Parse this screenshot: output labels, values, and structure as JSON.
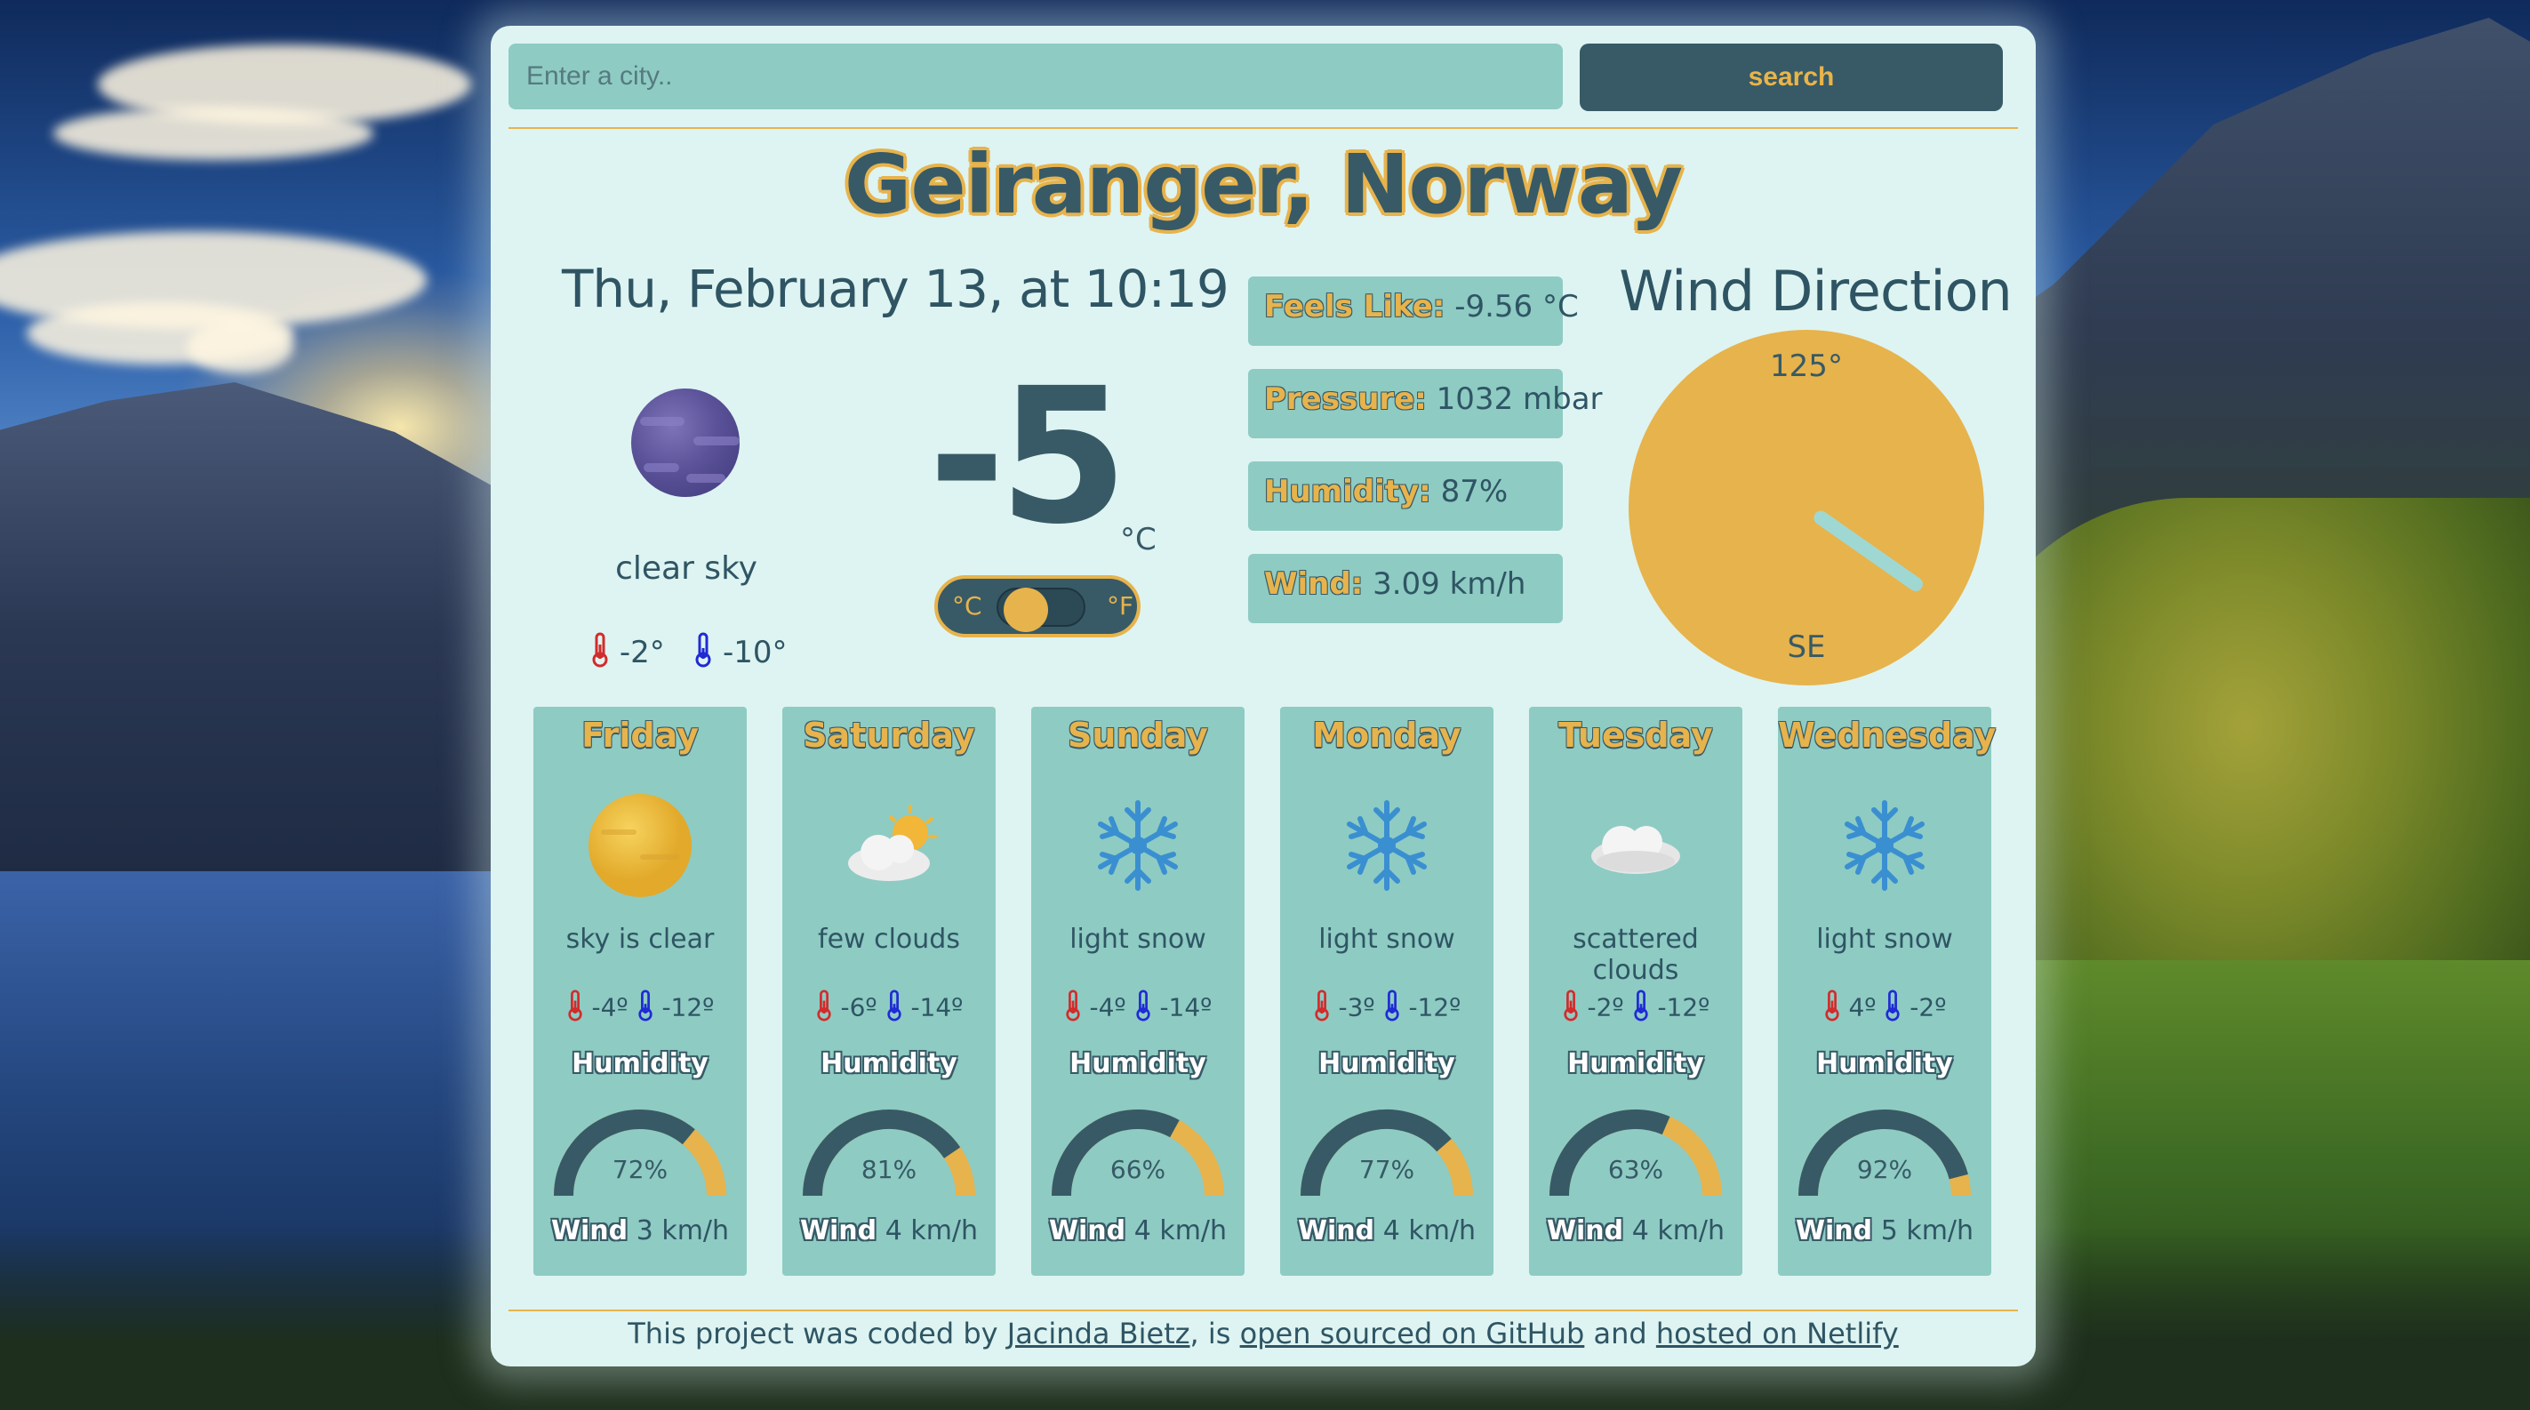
{
  "search": {
    "placeholder": "Enter a city..",
    "button_label": "search"
  },
  "current": {
    "city": "Geiranger, Norway",
    "datetime": "Thu, February 13, at 10:19",
    "icon": "moon-icon",
    "description": "clear sky",
    "high": "-2°",
    "low": "-10°",
    "temperature": "-5",
    "unit": "°C",
    "toggle": {
      "celsius_label": "°C",
      "fahrenheit_label": "°F",
      "selected": "celsius"
    },
    "stats": [
      {
        "label": "Feels Like:",
        "value": "-9.56 °C"
      },
      {
        "label": "Pressure:",
        "value": "1032 mbar"
      },
      {
        "label": "Humidity:",
        "value": "87%"
      },
      {
        "label": "Wind:",
        "value": "3.09 km/h"
      }
    ]
  },
  "wind_direction": {
    "title": "Wind Direction",
    "degrees_label": "125°",
    "degrees": 125,
    "cardinal": "SE"
  },
  "forecast": [
    {
      "day": "Friday",
      "icon": "sun-icon",
      "description": "sky is clear",
      "high": "-4º",
      "low": "-12º",
      "humidity_label": "Humidity",
      "humidity": 72,
      "humidity_text": "72%",
      "wind_label": "Wind",
      "wind": "3 km/h"
    },
    {
      "day": "Saturday",
      "icon": "few-clouds-icon",
      "description": "few clouds",
      "high": "-6º",
      "low": "-14º",
      "humidity_label": "Humidity",
      "humidity": 81,
      "humidity_text": "81%",
      "wind_label": "Wind",
      "wind": "4 km/h"
    },
    {
      "day": "Sunday",
      "icon": "snowflake-icon",
      "description": "light snow",
      "high": "-4º",
      "low": "-14º",
      "humidity_label": "Humidity",
      "humidity": 66,
      "humidity_text": "66%",
      "wind_label": "Wind",
      "wind": "4 km/h"
    },
    {
      "day": "Monday",
      "icon": "snowflake-icon",
      "description": "light snow",
      "high": "-3º",
      "low": "-12º",
      "humidity_label": "Humidity",
      "humidity": 77,
      "humidity_text": "77%",
      "wind_label": "Wind",
      "wind": "4 km/h"
    },
    {
      "day": "Tuesday",
      "icon": "cloud-icon",
      "description": "scattered clouds",
      "high": "-2º",
      "low": "-12º",
      "humidity_label": "Humidity",
      "humidity": 63,
      "humidity_text": "63%",
      "wind_label": "Wind",
      "wind": "4 km/h"
    },
    {
      "day": "Wednesday",
      "icon": "snowflake-icon",
      "description": "light snow",
      "high": "4º",
      "low": "-2º",
      "humidity_label": "Humidity",
      "humidity": 92,
      "humidity_text": "92%",
      "wind_label": "Wind",
      "wind": "5 km/h"
    }
  ],
  "footer": {
    "prefix": "This project was coded by",
    "author_link": "Jacinda Bietz",
    "middle": ", is",
    "github_link": "open sourced on GitHub",
    "and": "and",
    "netlify_link": "hosted on Netlify"
  },
  "colors": {
    "accent": "#e7b34c",
    "dark": "#375a66",
    "panel": "#8ecbc3",
    "card": "#def4f2",
    "hot": "#d32b2b",
    "cold": "#1f2ad6"
  }
}
